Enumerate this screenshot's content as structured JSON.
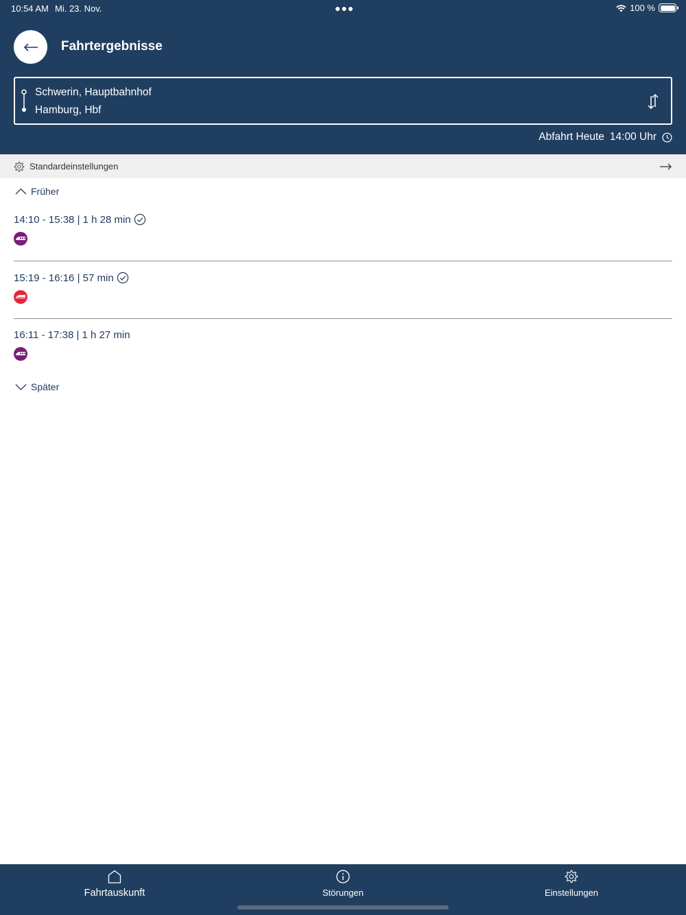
{
  "status": {
    "time": "10:54 AM",
    "date": "Mi. 23. Nov.",
    "battery": "100 %"
  },
  "header": {
    "title": "Fahrtergebnisse",
    "from": "Schwerin, Hauptbahnhof",
    "to": "Hamburg, Hbf",
    "departure_label": "Abfahrt Heute",
    "departure_time": "14:00 Uhr"
  },
  "settings_bar": {
    "label": "Standardeinstellungen"
  },
  "earlier_label": "Früher",
  "later_label": "Später",
  "trips": [
    {
      "summary": "14:10 - 15:38 | 1 h 28 min",
      "checked": true,
      "train_color": "#7a1e78"
    },
    {
      "summary": "15:19 - 16:16 | 57 min",
      "checked": true,
      "train_color": "#e8263b"
    },
    {
      "summary": "16:11 - 17:38 | 1 h 27 min",
      "checked": false,
      "train_color": "#7a1e78"
    }
  ],
  "tabs": [
    {
      "label": "Fahrtauskunft",
      "icon": "home-icon",
      "active": true
    },
    {
      "label": "Störungen",
      "icon": "info-icon",
      "active": false
    },
    {
      "label": "Einstellungen",
      "icon": "gear-icon",
      "active": false
    }
  ]
}
